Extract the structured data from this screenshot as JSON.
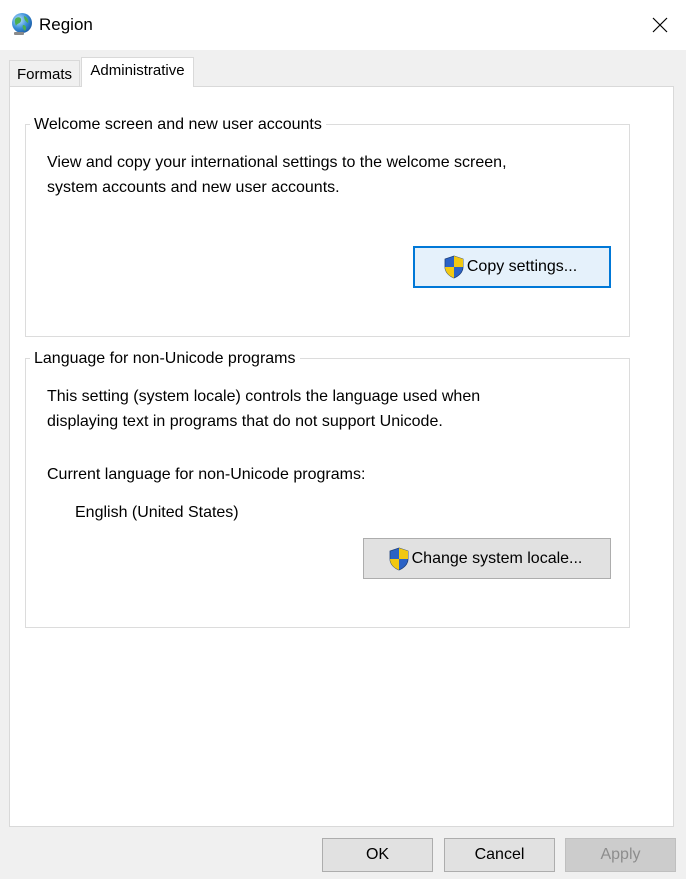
{
  "window": {
    "title": "Region",
    "icon": "globe-icon",
    "close_icon": "close-icon"
  },
  "tabs": [
    {
      "label": "Formats",
      "selected": false
    },
    {
      "label": "Administrative",
      "selected": true
    }
  ],
  "welcome_group": {
    "legend": "Welcome screen and new user accounts",
    "description_line1": "View and copy your international settings to the welcome screen,",
    "description_line2": "system accounts and new user accounts.",
    "button_label": "Copy settings...",
    "button_icon": "uac-shield-icon"
  },
  "locale_group": {
    "legend": "Language for non-Unicode programs",
    "description_line1": "This setting (system locale) controls the language used when",
    "description_line2": "displaying text in programs that do not support Unicode.",
    "current_label": "Current language for non-Unicode programs:",
    "current_value": "English (United States)",
    "button_label": "Change system locale...",
    "button_icon": "uac-shield-icon"
  },
  "footer": {
    "ok_label": "OK",
    "cancel_label": "Cancel",
    "apply_label": "Apply",
    "apply_enabled": false
  },
  "colors": {
    "focus_border": "#0078d7",
    "shield_blue": "#2b62c5",
    "shield_yellow": "#f2c811"
  }
}
